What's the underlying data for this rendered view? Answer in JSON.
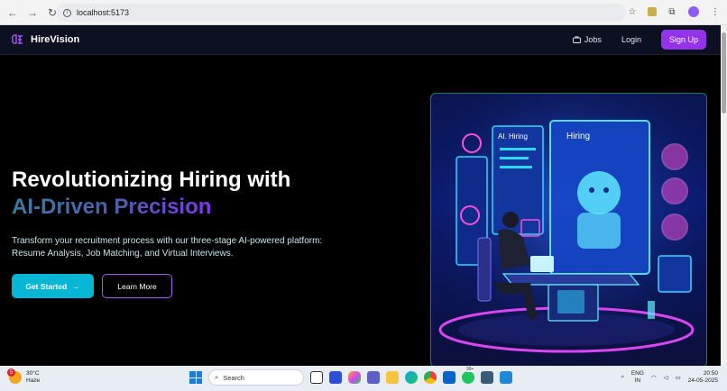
{
  "browser": {
    "url": "localhost:5173",
    "back": "←",
    "forward": "→",
    "reload": "↻",
    "info": "i",
    "star": "☆",
    "extensions": "⧉",
    "menu": "⋮"
  },
  "navbar": {
    "brand": "HireVision",
    "jobs_label": "Jobs",
    "login_label": "Login",
    "signup_label": "Sign Up"
  },
  "hero": {
    "title_line1": "Revolutionizing Hiring with",
    "title_line2": "AI-Driven Precision",
    "subtitle_line1": "Transform your recruitment process with our three-stage AI-powered platform:",
    "subtitle_line2": "Resume Analysis, Job Matching, and Virtual Interviews.",
    "primary_button": "Get Started",
    "primary_arrow": "→",
    "secondary_button": "Learn More",
    "image_labels": {
      "ai_hiring": "AI. Hiring",
      "hiring": "Hiring"
    }
  },
  "taskbar": {
    "weather_temp": "30°C",
    "weather_desc": "Haze",
    "weather_badge": "5",
    "search_placeholder": "Search",
    "lang_top": "ENG",
    "lang_bottom": "IN",
    "time": "20:50",
    "date": "24-05-2025",
    "notif_badge": "99+"
  },
  "colors": {
    "accent_purple": "#9333ea",
    "accent_cyan": "#06b6d4",
    "nav_bg": "#0c1020"
  }
}
